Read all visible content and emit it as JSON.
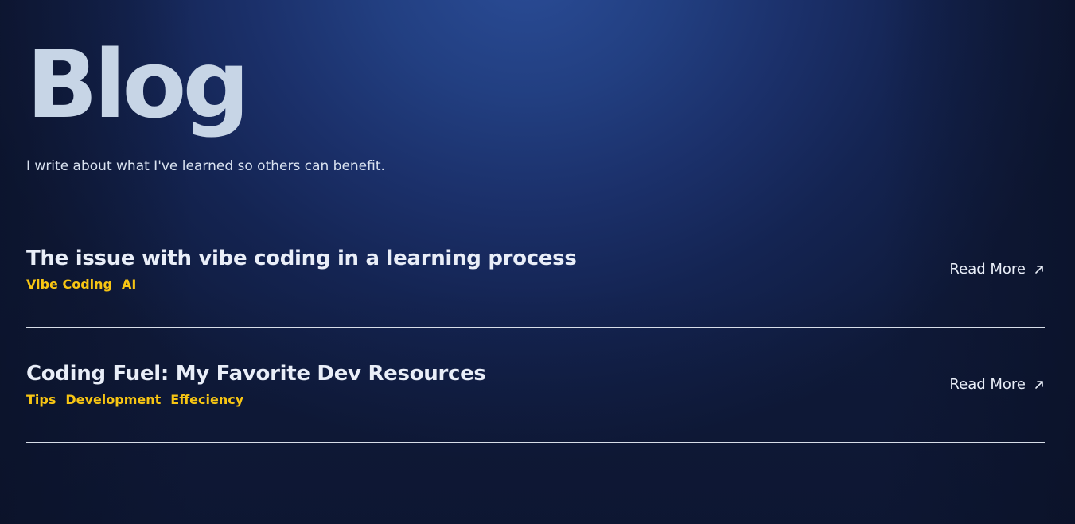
{
  "header": {
    "title": "Blog",
    "subtitle": "I write about what I've learned so others can benefit."
  },
  "posts": [
    {
      "title": "The issue with vibe coding in a learning process",
      "tags": [
        "Vibe Coding",
        "AI"
      ],
      "read_more_label": "Read More",
      "read_more_icon": "arrow-up-right-icon"
    },
    {
      "title": "Coding Fuel: My Favorite Dev Resources",
      "tags": [
        "Tips",
        "Development",
        "Effeciency"
      ],
      "read_more_label": "Read More",
      "read_more_icon": "arrow-up-right-icon"
    }
  ],
  "colors": {
    "background": "#1b306a",
    "title": "#c7d5e6",
    "text": "#e9eef8",
    "tag": "#f7c513",
    "divider": "#d7dde8"
  }
}
